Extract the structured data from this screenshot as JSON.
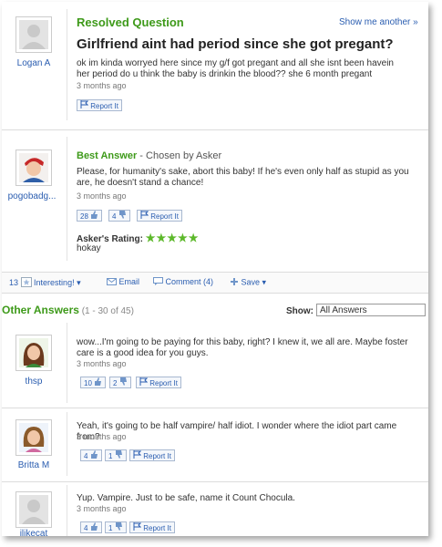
{
  "question": {
    "heading": "Resolved Question",
    "show_another": "Show me another »",
    "asker": "Logan A",
    "title": "Girlfriend aint had period since she got pregant?",
    "body": "ok im kinda worryed here since my g/f got pregant and all she isnt been havein her period do u think the baby is drinkin the blood?? she 6 month pregant",
    "time": "3 months ago",
    "report": "Report It"
  },
  "best_answer": {
    "label": "Best Answer",
    "chosen": " - Chosen by Asker",
    "user": "pogobadg...",
    "text": "Please, for humanity's sake, abort this baby! If he's even only half as stupid as you are, he doesn't stand a chance!",
    "time": "3 months ago",
    "thumbs_up": "28",
    "thumbs_down": "4",
    "report": "Report It",
    "rating_label": "Asker's Rating:",
    "stars": "★★★★★",
    "rating_comment": "hokay"
  },
  "actions": {
    "count": "13",
    "interesting": "Interesting!",
    "email": "Email",
    "comment": "Comment (4)",
    "save": "Save"
  },
  "other_answers": {
    "heading": "Other Answers",
    "range": " (1 - 30 of 45)",
    "show_label": "Show:",
    "show_value": "All Answers",
    "items": [
      {
        "user": "thsp",
        "text": "wow...I'm going to be paying for this baby, right? I knew it, we all are. Maybe foster care is a good idea for you guys.",
        "time": "3 months ago",
        "up": "10",
        "down": "2",
        "report": "Report It"
      },
      {
        "user": "Britta M",
        "text": "Yeah, it's going to be half vampire/ half idiot. I wonder where the idiot part came from?",
        "time": "3 months ago",
        "up": "4",
        "down": "1",
        "report": "Report It"
      },
      {
        "user": "ilikecat",
        "text": "Yup. Vampire. Just to be safe, name it Count Chocula.",
        "time": "3 months ago",
        "up": "4",
        "down": "1",
        "report": "Report It"
      }
    ]
  },
  "colors": {
    "green": "#3e9a1a",
    "link": "#2a5db0"
  }
}
